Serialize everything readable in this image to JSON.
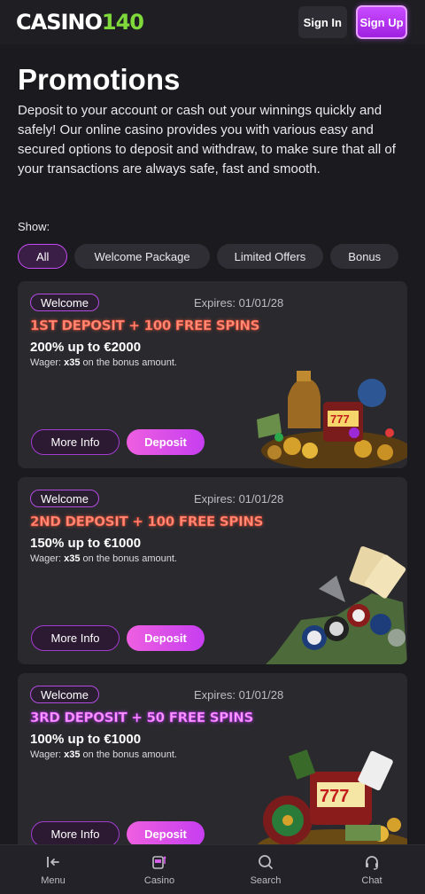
{
  "header": {
    "logo_part1": "CASINO",
    "logo_part2": "140",
    "signin_label": "Sign In",
    "signup_label": "Sign Up"
  },
  "page": {
    "title": "Promotions",
    "intro": "Deposit to your account or cash out your winnings quickly and safely! Our online casino provides you with various easy and secured options to deposit and withdraw, to make sure that all of your transactions are always safe, fast and smooth.",
    "show_label": "Show:"
  },
  "filters": [
    {
      "label": "All",
      "active": true
    },
    {
      "label": "Welcome Package",
      "active": false
    },
    {
      "label": "Limited Offers",
      "active": false
    },
    {
      "label": "Bonus",
      "active": false
    }
  ],
  "promotions": [
    {
      "badge": "Welcome",
      "expires": "Expires: 01/01/28",
      "title": "1ST DEPOSIT + 100 FREE SPINS",
      "offer": "200% up to €2000",
      "wager_label": "Wager:",
      "wager_value": "x35",
      "wager_rest": "on the bonus amount.",
      "more_label": "More Info",
      "deposit_label": "Deposit"
    },
    {
      "badge": "Welcome",
      "expires": "Expires: 01/01/28",
      "title": "2ND DEPOSIT + 100 FREE SPINS",
      "offer": "150% up to €1000",
      "wager_label": "Wager:",
      "wager_value": "x35",
      "wager_rest": "on the bonus amount.",
      "more_label": "More Info",
      "deposit_label": "Deposit"
    },
    {
      "badge": "Welcome",
      "expires": "Expires: 01/01/28",
      "title": "3RD DEPOSIT + 50 FREE SPINS",
      "offer": "100% up to €1000",
      "wager_label": "Wager:",
      "wager_value": "x35",
      "wager_rest": "on the bonus amount.",
      "more_label": "More Info",
      "deposit_label": "Deposit"
    }
  ],
  "bottom_nav": [
    {
      "label": "Menu",
      "icon": "menu-icon"
    },
    {
      "label": "Casino",
      "icon": "slot-machine-icon"
    },
    {
      "label": "Search",
      "icon": "search-icon"
    },
    {
      "label": "Chat",
      "icon": "headset-icon"
    }
  ],
  "colors": {
    "background": "#1b1a1f",
    "card": "#2a292e",
    "accent": "#c64bf5",
    "logo_green": "#7fd93a"
  }
}
